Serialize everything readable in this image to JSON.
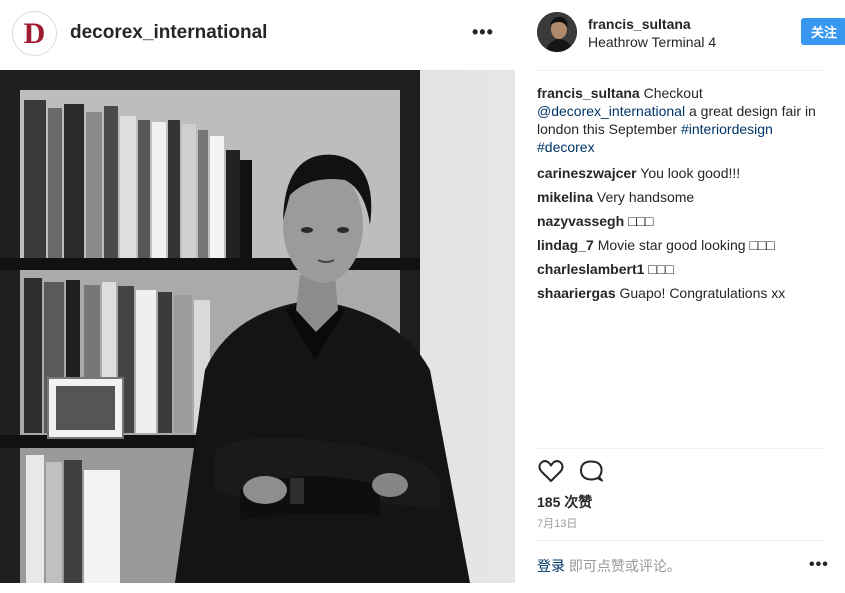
{
  "header": {
    "logo_letter": "D",
    "account_name": "decorex_international",
    "more_label": "•••"
  },
  "post_author": {
    "username": "francis_sultana",
    "location": "Heathrow Terminal 4",
    "follow_label": "关注"
  },
  "caption": {
    "username": "francis_sultana",
    "text_1": "Checkout",
    "mention": "@decorex_international",
    "text_2": "a great design fair in london this September",
    "hashtag_1": "#interiordesign",
    "hashtag_2": "#decorex"
  },
  "comments": [
    {
      "username": "carineszwajcer",
      "text": "You look good!!!"
    },
    {
      "username": "mikelina",
      "text": "Very handsome"
    },
    {
      "username": "nazyvassegh",
      "text": "□□□"
    },
    {
      "username": "lindag_7",
      "text": "Movie star good looking □□□"
    },
    {
      "username": "charleslambert1",
      "text": "□□□"
    },
    {
      "username": "shaariergas",
      "text": "Guapo! Congratulations xx"
    }
  ],
  "likes": "185 次赞",
  "date": "7月13日",
  "login_prompt": {
    "link": "登录",
    "text": "即可点赞或评论。"
  },
  "more_options_label": "•••",
  "icons": {
    "like": "heart-icon",
    "comment": "comment-bubble-icon",
    "brand": "logo-d"
  }
}
